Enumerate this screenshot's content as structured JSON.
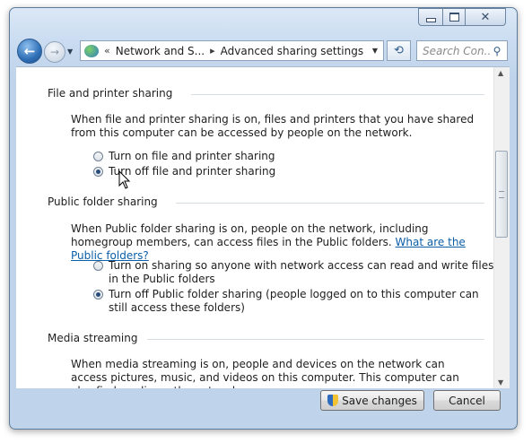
{
  "window": {
    "buttons": {
      "minimize": "minimize",
      "maximize": "maximize",
      "close": "close"
    }
  },
  "nav": {
    "back_icon": "back-arrow-icon",
    "forward_icon": "forward-arrow-icon"
  },
  "address": {
    "overflow_chevron": "«",
    "crumbs": [
      "Network and S...",
      "Advanced sharing settings"
    ],
    "separator": "▸"
  },
  "search": {
    "placeholder": "Search Con..."
  },
  "sections": {
    "file_printer": {
      "title": "File and printer sharing",
      "description": "When file and printer sharing is on, files and printers that you have shared from this computer can be accessed by people on the network.",
      "options": [
        {
          "label": "Turn on file and printer sharing",
          "selected": false
        },
        {
          "label": "Turn off file and printer sharing",
          "selected": true
        }
      ]
    },
    "public_folder": {
      "title": "Public folder sharing",
      "description": "When Public folder sharing is on, people on the network, including homegroup members, can access files in the Public folders.",
      "link": "What are the Public folders?",
      "options": [
        {
          "label": "Turn on sharing so anyone with network access can read and write files in the Public folders",
          "selected": false
        },
        {
          "label": "Turn off Public folder sharing (people logged on to this computer can still access these folders)",
          "selected": true
        }
      ]
    },
    "media": {
      "title": "Media streaming",
      "description": "When media streaming is on, people and devices on the network can access pictures, music, and videos on this computer. This computer can also find media on the network."
    }
  },
  "buttons": {
    "save": "Save changes",
    "cancel": "Cancel"
  },
  "colors": {
    "link": "#0b5ea8",
    "window_frame": "#bfd3ea"
  }
}
